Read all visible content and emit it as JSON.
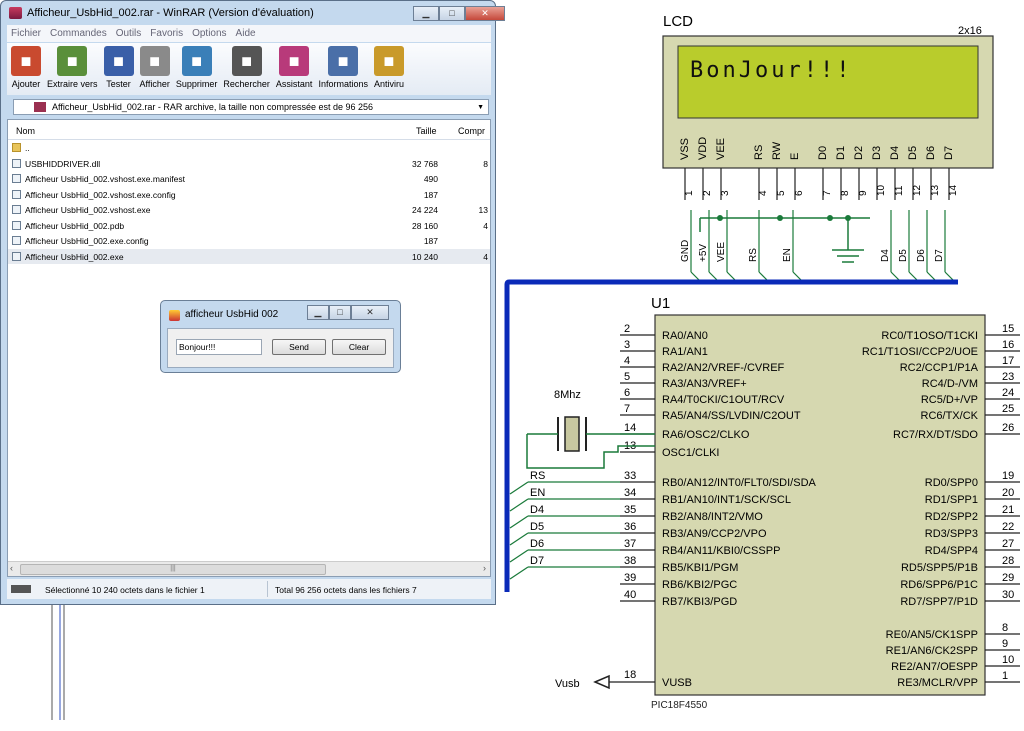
{
  "winrar": {
    "title": "Afficheur_UsbHid_002.rar - WinRAR (Version d'évaluation)",
    "menu": [
      "Fichier",
      "Commandes",
      "Outils",
      "Favoris",
      "Options",
      "Aide"
    ],
    "toolbar": [
      {
        "label": "Ajouter",
        "icon": "add-archive-icon",
        "color": "#c94a2f"
      },
      {
        "label": "Extraire vers",
        "icon": "extract-icon",
        "color": "#5a8f3a"
      },
      {
        "label": "Tester",
        "icon": "test-icon",
        "color": "#3a5fa8"
      },
      {
        "label": "Afficher",
        "icon": "view-icon",
        "color": "#8a8a8a"
      },
      {
        "label": "Supprimer",
        "icon": "delete-icon",
        "color": "#3a7fb8"
      },
      {
        "label": "Rechercher",
        "icon": "find-icon",
        "color": "#555555"
      },
      {
        "label": "Assistant",
        "icon": "wizard-icon",
        "color": "#b83a7a"
      },
      {
        "label": "Informations",
        "icon": "info-icon",
        "color": "#4a6fa8"
      },
      {
        "label": "Antiviru",
        "icon": "antivirus-icon",
        "color": "#c99a2a"
      }
    ],
    "address": "Afficheur_UsbHid_002.rar - RAR archive, la taille non compressée est de 96 256",
    "columns": {
      "name": "Nom",
      "size": "Taille",
      "compressed": "Compr"
    },
    "files": [
      {
        "name": "..",
        "size": "",
        "compr": "",
        "icon": "folder-up-icon"
      },
      {
        "name": "USBHIDDRIVER.dll",
        "size": "32 768",
        "compr": "8",
        "icon": "dll-file-icon"
      },
      {
        "name": "Afficheur UsbHid_002.vshost.exe.manifest",
        "size": "490",
        "compr": "",
        "icon": "manifest-file-icon"
      },
      {
        "name": "Afficheur UsbHid_002.vshost.exe.config",
        "size": "187",
        "compr": "",
        "icon": "config-file-icon"
      },
      {
        "name": "Afficheur UsbHid_002.vshost.exe",
        "size": "24 224",
        "compr": "13",
        "icon": "exe-file-icon"
      },
      {
        "name": "Afficheur UsbHid_002.pdb",
        "size": "28 160",
        "compr": "4",
        "icon": "pdb-file-icon"
      },
      {
        "name": "Afficheur UsbHid_002.exe.config",
        "size": "187",
        "compr": "",
        "icon": "config-file-icon"
      },
      {
        "name": "Afficheur UsbHid_002.exe",
        "size": "10 240",
        "compr": "4",
        "icon": "exe-file-icon"
      }
    ],
    "status_selected": "Sélectionné 10 240 octets dans le fichier 1",
    "status_total": "Total 96 256 octets dans les fichiers 7"
  },
  "dialog": {
    "title": "afficheur UsbHid 002",
    "input_value": "Bonjour!!!",
    "send_label": "Send",
    "clear_label": "Clear"
  },
  "lcd": {
    "label": "LCD",
    "size_label": "2x16",
    "display_text": "BonJour!!!",
    "pins": [
      "VSS",
      "VDD",
      "VEE",
      "RS",
      "RW",
      "E",
      "D0",
      "D1",
      "D2",
      "D3",
      "D4",
      "D5",
      "D6",
      "D7"
    ],
    "pin_numbers": [
      "1",
      "2",
      "3",
      "4",
      "5",
      "6",
      "7",
      "8",
      "9",
      "10",
      "11",
      "12",
      "13",
      "14"
    ],
    "net_labels": [
      "GND",
      "+5V",
      "VEE",
      "RS",
      "EN",
      "D4",
      "D5",
      "D6",
      "D7"
    ]
  },
  "mcu": {
    "ref": "U1",
    "part": "PIC18F4550",
    "left_pins": [
      {
        "n": "2",
        "name": "RA0/AN0"
      },
      {
        "n": "3",
        "name": "RA1/AN1"
      },
      {
        "n": "4",
        "name": "RA2/AN2/VREF-/CVREF"
      },
      {
        "n": "5",
        "name": "RA3/AN3/VREF+"
      },
      {
        "n": "6",
        "name": "RA4/T0CKI/C1OUT/RCV"
      },
      {
        "n": "7",
        "name": "RA5/AN4/SS/LVDIN/C2OUT"
      },
      {
        "n": "14",
        "name": "RA6/OSC2/CLKO"
      },
      {
        "n": "13",
        "name": "OSC1/CLKI"
      },
      {
        "n": "33",
        "name": "RB0/AN12/INT0/FLT0/SDI/SDA"
      },
      {
        "n": "34",
        "name": "RB1/AN10/INT1/SCK/SCL"
      },
      {
        "n": "35",
        "name": "RB2/AN8/INT2/VMO"
      },
      {
        "n": "36",
        "name": "RB3/AN9/CCP2/VPO"
      },
      {
        "n": "37",
        "name": "RB4/AN11/KBI0/CSSPP"
      },
      {
        "n": "38",
        "name": "RB5/KBI1/PGM"
      },
      {
        "n": "39",
        "name": "RB6/KBI2/PGC"
      },
      {
        "n": "40",
        "name": "RB7/KBI3/PGD"
      }
    ],
    "right_pins": [
      {
        "n": "15",
        "name": "RC0/T1OSO/T1CKI"
      },
      {
        "n": "16",
        "name": "RC1/T1OSI/CCP2/UOE"
      },
      {
        "n": "17",
        "name": "RC2/CCP1/P1A"
      },
      {
        "n": "23",
        "name": "RC4/D-/VM"
      },
      {
        "n": "24",
        "name": "RC5/D+/VP"
      },
      {
        "n": "25",
        "name": "RC6/TX/CK"
      },
      {
        "n": "26",
        "name": "RC7/RX/DT/SDO"
      },
      {
        "n": "19",
        "name": "RD0/SPP0"
      },
      {
        "n": "20",
        "name": "RD1/SPP1"
      },
      {
        "n": "21",
        "name": "RD2/SPP2"
      },
      {
        "n": "22",
        "name": "RD3/SPP3"
      },
      {
        "n": "27",
        "name": "RD4/SPP4"
      },
      {
        "n": "28",
        "name": "RD5/SPP5/P1B"
      },
      {
        "n": "29",
        "name": "RD6/SPP6/P1C"
      },
      {
        "n": "30",
        "name": "RD7/SPP7/P1D"
      },
      {
        "n": "8",
        "name": "RE0/AN5/CK1SPP"
      },
      {
        "n": "9",
        "name": "RE1/AN6/CK2SPP"
      },
      {
        "n": "10",
        "name": "RE2/AN7/OESPP"
      },
      {
        "n": "1",
        "name": "RE3/MCLR/VPP"
      }
    ],
    "vusb_pin": {
      "n": "18",
      "name": "VUSB"
    },
    "bus_labels": [
      "RS",
      "EN",
      "D4",
      "D5",
      "D6",
      "D7"
    ]
  },
  "crystal": {
    "label": "8Mhz"
  },
  "vusb_label": "Vusb"
}
